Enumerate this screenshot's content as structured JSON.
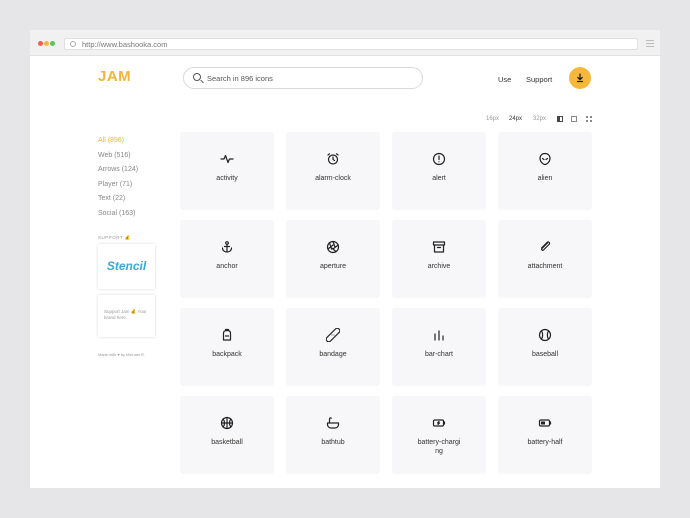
{
  "browser": {
    "url": "http://www.bashooka.com"
  },
  "header": {
    "logo": "JAM",
    "search_placeholder": "Search in 896 icons",
    "nav": {
      "use": "Use",
      "support": "Support"
    },
    "download_icon": "download-icon"
  },
  "toolbar": {
    "sizes": [
      "16px",
      "24px",
      "32px"
    ],
    "selected_size": "24px",
    "view_icons": [
      "grid-small-icon",
      "square-icon",
      "grid-icon"
    ]
  },
  "sidebar": {
    "categories": [
      {
        "label": "All (896)",
        "active": true
      },
      {
        "label": "Web (516)",
        "active": false
      },
      {
        "label": "Arrows (124)",
        "active": false
      },
      {
        "label": "Player (71)",
        "active": false
      },
      {
        "label": "Text (22)",
        "active": false
      },
      {
        "label": "Social (163)",
        "active": false
      }
    ],
    "support_label": "SUPPORT 💰",
    "ad_stencil": "Stencil",
    "ad_jam": "Support Jam 💰 Your brand here.",
    "footer": "Made with ♥ by Michael R."
  },
  "icons": [
    {
      "name": "activity",
      "icon": "activity-icon"
    },
    {
      "name": "alarm-clock",
      "icon": "alarm-clock-icon"
    },
    {
      "name": "alert",
      "icon": "alert-icon"
    },
    {
      "name": "alien",
      "icon": "alien-icon"
    },
    {
      "name": "anchor",
      "icon": "anchor-icon"
    },
    {
      "name": "aperture",
      "icon": "aperture-icon"
    },
    {
      "name": "archive",
      "icon": "archive-icon"
    },
    {
      "name": "attachment",
      "icon": "attachment-icon"
    },
    {
      "name": "backpack",
      "icon": "backpack-icon"
    },
    {
      "name": "bandage",
      "icon": "bandage-icon"
    },
    {
      "name": "bar-chart",
      "icon": "bar-chart-icon"
    },
    {
      "name": "baseball",
      "icon": "baseball-icon"
    },
    {
      "name": "basketball",
      "icon": "basketball-icon"
    },
    {
      "name": "bathtub",
      "icon": "bathtub-icon"
    },
    {
      "name": "battery-charging",
      "icon": "battery-charging-icon"
    },
    {
      "name": "battery-half",
      "icon": "battery-half-icon"
    }
  ],
  "colors": {
    "accent": "#f2b43c",
    "card_bg": "#f7f7f9"
  }
}
